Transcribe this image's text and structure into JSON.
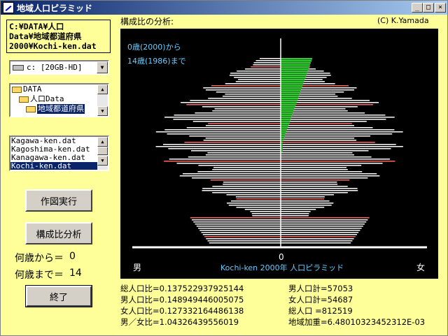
{
  "window": {
    "title": "地域人口ピラミッド",
    "controls": [
      "_",
      "□",
      "×"
    ]
  },
  "path_label": "C:¥DATA¥人口\nData¥地域都道府県\n2000¥Kochi-ken.dat",
  "drive": {
    "selected": "c: [20GB-HD]"
  },
  "directories": [
    {
      "label": "DATA",
      "indent": 0,
      "selected": false
    },
    {
      "label": "人口Data",
      "indent": 1,
      "selected": false
    },
    {
      "label": "地域都道府県",
      "indent": 2,
      "selected": true
    }
  ],
  "files": [
    {
      "label": "Kagawa-ken.dat",
      "selected": false
    },
    {
      "label": "Kagoshima-ken.dat",
      "selected": false
    },
    {
      "label": "Kanagawa-ken.dat",
      "selected": false
    },
    {
      "label": "Kochi-ken.dat",
      "selected": true
    }
  ],
  "buttons": {
    "draw": "作図実行",
    "ratio": "構成比分析",
    "exit": "終了"
  },
  "age_range": {
    "from_label": "何歳から＝",
    "from_value": "0",
    "to_label": "何歳まで＝",
    "to_value": "14"
  },
  "chart": {
    "heading": "構成比の分析:",
    "credit": "(C) K.Yamada",
    "annotation_from": "0歳(2000)から",
    "annotation_to": "14歳(1986)まで",
    "axis_zero": "0",
    "male_label": "男",
    "female_label": "女",
    "caption": "Kochi-ken 2000年  人口ピラミッド",
    "colors": {
      "background": "#000000",
      "bars": "#ffffff",
      "highlight_male": "#ff6666",
      "highlight_female": "#33cc33",
      "axis": "#ffffff",
      "annotation": "#66ccff"
    }
  },
  "stats_left": [
    "総人口比=0.137522937925144",
    "男人口比=0.148949446005075",
    "女人口比=0.127332164486138",
    "男／女比=1.04326439556019"
  ],
  "stats_right": [
    "男人口計=57053",
    "女人口計=54687",
    "総人口  =812519",
    "地域加重=6.48010323452312E-03"
  ]
}
